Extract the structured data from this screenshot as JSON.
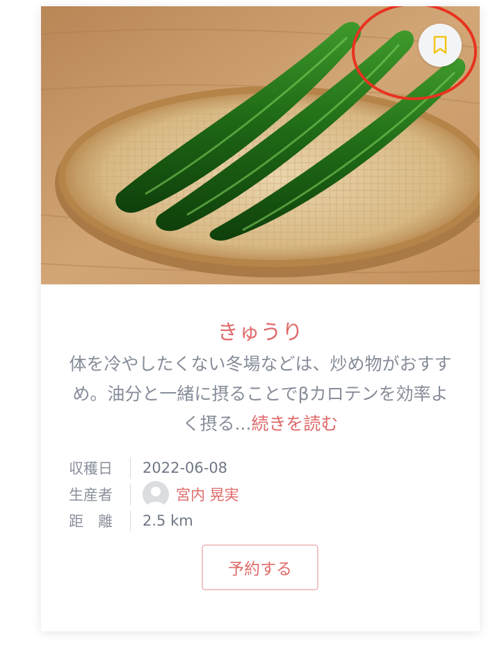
{
  "product": {
    "title": "きゅうり",
    "description": "体を冷やしたくない冬場などは、炒め物がおすすめ。油分と一緒に摂ることでβカロテンを効率よく摂る...",
    "read_more": "続きを読む",
    "image_subject": "cucumbers-on-bamboo-basket",
    "bookmark_icon": "bookmark-icon"
  },
  "meta": {
    "harvest_label": "収穫日",
    "harvest_value": "2022-06-08",
    "producer_label": "生産者",
    "producer_name": "宮内 晃実",
    "distance_label": "距　離",
    "distance_value": "2.5 km"
  },
  "actions": {
    "reserve_label": "予約する"
  },
  "colors": {
    "accent": "#e06a6a",
    "bookmark": "#f5c518",
    "highlight_ring": "#e8321f",
    "muted_text": "#868d99"
  }
}
